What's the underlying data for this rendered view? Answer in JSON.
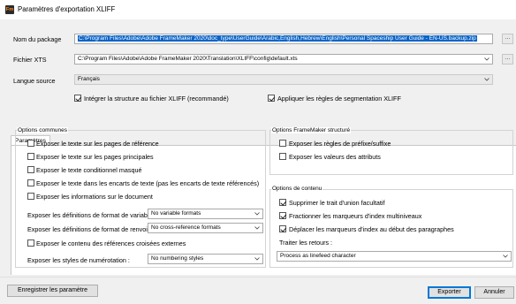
{
  "window": {
    "title": "Paramètres d'exportation XLIFF",
    "app_icon": "Fm"
  },
  "package": {
    "label": "Nom du package",
    "value": "C:\\Program Files\\Adobe\\Adobe FrameMaker 2020\\doc_type\\UserGuide\\Arabic,English,Hebrew\\English\\Personal Spaceship User Guide - EN-US.backup.zip",
    "browse": "..."
  },
  "xts": {
    "label": "Fichier XTS",
    "value": "C:\\Program Files\\Adobe\\Adobe FrameMaker 2020\\Translation\\XLIFF\\config\\default.xts",
    "browse": "..."
  },
  "source_lang": {
    "label": "Langue source",
    "value": "Français"
  },
  "options_top": [
    {
      "label": "Intégrer la structure au fichier XLIFF (recommandé)",
      "checked": true
    },
    {
      "label": "Appliquer les règles de segmentation XLIFF",
      "checked": true
    }
  ],
  "tab": {
    "label": "Paramètres MIF"
  },
  "common": {
    "title": "Options communes",
    "checkboxes": [
      {
        "label": "Exposer le texte sur les pages de référence",
        "checked": false
      },
      {
        "label": "Exposer le texte sur les pages principales",
        "checked": false
      },
      {
        "label": "Exposer le texte conditionnel masqué",
        "checked": false
      },
      {
        "label": "Exposer le texte dans les encarts de texte (pas les encarts de texte référencés)",
        "checked": false
      },
      {
        "label": "Exposer les informations sur le document",
        "checked": false
      }
    ],
    "var_formats": {
      "label": "Exposer les définitions de format de variable",
      "value": "No variable formats"
    },
    "xref_formats": {
      "label": "Exposer les définitions de format de renvoi:",
      "value": "No cross-reference formats"
    },
    "xref_content": {
      "label": "Exposer le contenu des références croisées externes",
      "checked": false
    },
    "numbering": {
      "label": "Exposer les styles de numérotation :",
      "value": "No numbering styles"
    }
  },
  "structured": {
    "title": "Options FrameMaker structuré",
    "checkboxes": [
      {
        "label": "Exposer les règles de préfixe/suffixe",
        "checked": false
      },
      {
        "label": "Exposer les valeurs des attributs",
        "checked": false
      }
    ]
  },
  "content": {
    "title": "Options de contenu",
    "checkboxes": [
      {
        "label": "Supprimer le trait d'union facultatif",
        "checked": true
      },
      {
        "label": "Fractionner les marqueurs d'index multiniveaux",
        "checked": true
      },
      {
        "label": "Déplacer les marqueurs d'index au début des paragraphes",
        "checked": true
      }
    ],
    "returns": {
      "label": "Traiter les retours :",
      "value": "Process as linefeed character"
    }
  },
  "buttons": {
    "save": "Enregistrer les paramètre",
    "export": "Exporter",
    "cancel": "Annuler"
  }
}
